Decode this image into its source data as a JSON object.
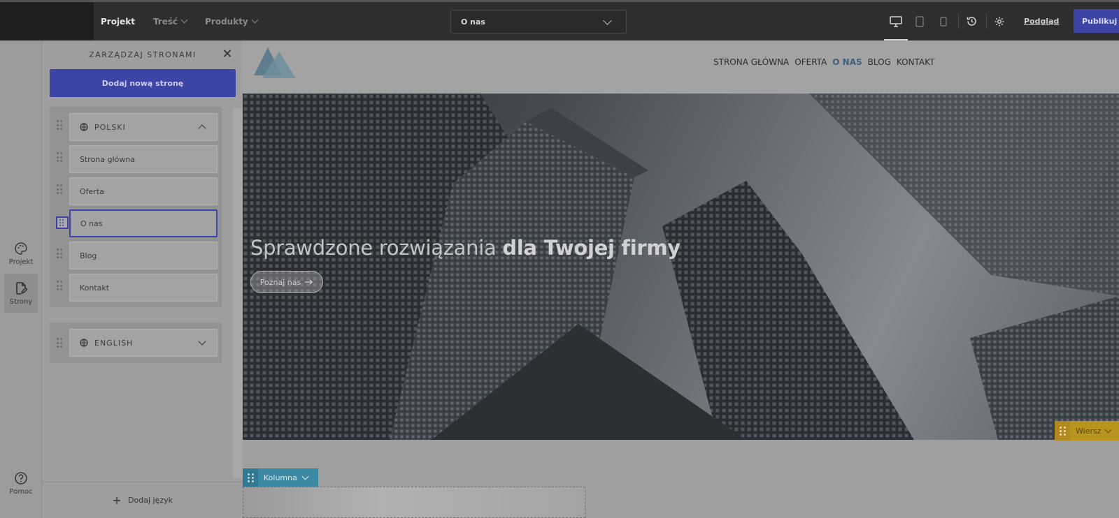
{
  "topbar": {
    "menu": [
      {
        "label": "Projekt",
        "active": true,
        "dropdown": false
      },
      {
        "label": "Treść",
        "active": false,
        "dropdown": true
      },
      {
        "label": "Produkty",
        "active": false,
        "dropdown": true
      }
    ],
    "page_select": "O nas",
    "preview_label": "Podgląd",
    "publish_label": "Publikuj",
    "icons": [
      "desktop-icon",
      "tablet-icon",
      "mobile-icon",
      "history-icon",
      "gear-icon"
    ]
  },
  "rail": {
    "items": [
      {
        "label": "Projekt",
        "icon": "palette-icon"
      },
      {
        "label": "Strony",
        "icon": "page-edit-icon"
      },
      {
        "label": "Pomoc",
        "icon": "help-icon"
      }
    ]
  },
  "panel": {
    "title": "ZARZĄDZAJ STRONAMI",
    "add_page_label": "Dodaj nową stronę",
    "languages": [
      {
        "name": "POLSKI",
        "expanded": true,
        "pages": [
          "Strona główna",
          "Oferta",
          "O nas",
          "Blog",
          "Kontakt"
        ]
      },
      {
        "name": "ENGLISH",
        "expanded": false,
        "pages": []
      }
    ],
    "selected_page": "O nas",
    "add_language_label": "Dodaj język"
  },
  "site": {
    "nav": [
      "STRONA GŁÓWNA",
      "OFERTA",
      "O NAS",
      "BLOG",
      "KONTAKT"
    ],
    "nav_active": "O NAS",
    "hero_title_light": "Sprawdzone rozwiązania",
    "hero_title_bold": "dla Twojej firmy",
    "hero_button": "Poznaj nas",
    "row_badge": "Wiersz",
    "column_badge": "Kolumna"
  },
  "colors": {
    "accent": "#3c45a6",
    "row_badge": "#b8951f",
    "column_badge": "#3b89a2"
  }
}
